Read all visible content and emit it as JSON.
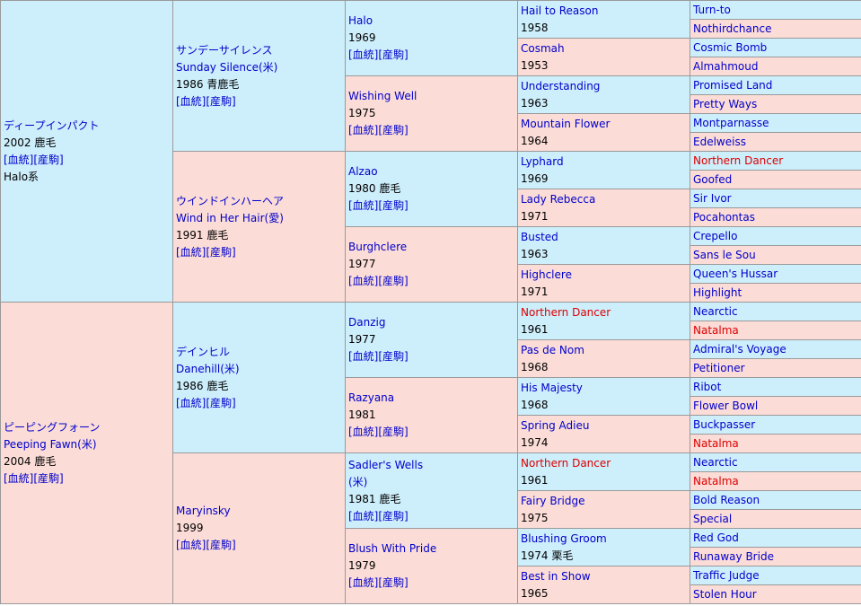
{
  "horses": {
    "h1": {
      "name": "ディープインパクト",
      "year": "2002 鹿毛",
      "links": "[血統][産駒]",
      "line": "Halo系"
    },
    "h2": {
      "name": "ピーピングフォーン",
      "en": "Peeping Fawn(米)",
      "year": "2004 鹿毛",
      "links": "[血統][産駒]"
    },
    "h11": {
      "name": "サンデーサイレンス",
      "en": "Sunday Silence(米)",
      "year": "1986 青鹿毛",
      "links": "[血統][産駒]"
    },
    "h12": {
      "name": "ウインドインハーヘア",
      "en": "Wind in Her Hair(愛)",
      "year": "1991 鹿毛",
      "links": "[血統][産駒]"
    },
    "h21": {
      "name": "デインヒル",
      "en": "Danehill(米)",
      "year": "1986 鹿毛",
      "links": "[血統][産駒]"
    },
    "h22": {
      "name": "Maryinsky",
      "year": "1999",
      "links": "[血統][産駒]"
    },
    "h111": {
      "name": "Halo",
      "year": "1969",
      "links": "[血統][産駒]"
    },
    "h112": {
      "name": "Wishing Well",
      "year": "1975",
      "links": "[血統][産駒]"
    },
    "h121": {
      "name": "Alzao",
      "year": "1980 鹿毛",
      "links": "[血統][産駒]"
    },
    "h122": {
      "name": "Burghclere",
      "year": "1977",
      "links": "[血統][産駒]"
    },
    "h211": {
      "name": "Danzig",
      "year": "1977",
      "links": "[血統][産駒]"
    },
    "h212": {
      "name": "Razyana",
      "year": "1981",
      "links": "[血統][産駒]"
    },
    "h221": {
      "name": "Sadler's Wells",
      "en": "(米)",
      "year": "1981 鹿毛",
      "links": "[血統][産駒]"
    },
    "h222": {
      "name": "Blush With Pride",
      "year": "1979",
      "links": "[血統][産駒]"
    },
    "g4": [
      {
        "name": "Hail to Reason",
        "year": "1958"
      },
      {
        "name": "Cosmah",
        "year": "1953"
      },
      {
        "name": "Understanding",
        "year": "1963"
      },
      {
        "name": "Mountain Flower",
        "year": "1964"
      },
      {
        "name": "Lyphard",
        "year": "1969"
      },
      {
        "name": "Lady Rebecca",
        "year": "1971"
      },
      {
        "name": "Busted",
        "year": "1963"
      },
      {
        "name": "Highclere",
        "year": "1971"
      },
      {
        "name": "Northern Dancer",
        "year": "1961"
      },
      {
        "name": "Pas de Nom",
        "year": "1968"
      },
      {
        "name": "His Majesty",
        "year": "1968"
      },
      {
        "name": "Spring Adieu",
        "year": "1974"
      },
      {
        "name": "Northern Dancer",
        "year": "1961"
      },
      {
        "name": "Fairy Bridge",
        "year": "1975"
      },
      {
        "name": "Blushing Groom",
        "year": "1974 栗毛"
      },
      {
        "name": "Best in Show",
        "year": "1965"
      }
    ],
    "g5": [
      "Turn-to",
      "Nothirdchance",
      "Cosmic Bomb",
      "Almahmoud",
      "Promised Land",
      "Pretty Ways",
      "Montparnasse",
      "Edelweiss",
      "Northern Dancer",
      "Goofed",
      "Sir Ivor",
      "Pocahontas",
      "Crepello",
      "Sans le Sou",
      "Queen's Hussar",
      "Highlight",
      "Nearctic",
      "Natalma",
      "Admiral's Voyage",
      "Petitioner",
      "Ribot",
      "Flower Bowl",
      "Buckpasser",
      "Natalma",
      "Nearctic",
      "Natalma",
      "Bold Reason",
      "Special",
      "Red God",
      "Runaway Bride",
      "Traffic Judge",
      "Stolen Hour"
    ]
  },
  "colors": {
    "male_bg": "#cdeefb",
    "female_bg": "#fbdcd6",
    "link": "#0000cc",
    "inbreed": "#dd0000"
  }
}
